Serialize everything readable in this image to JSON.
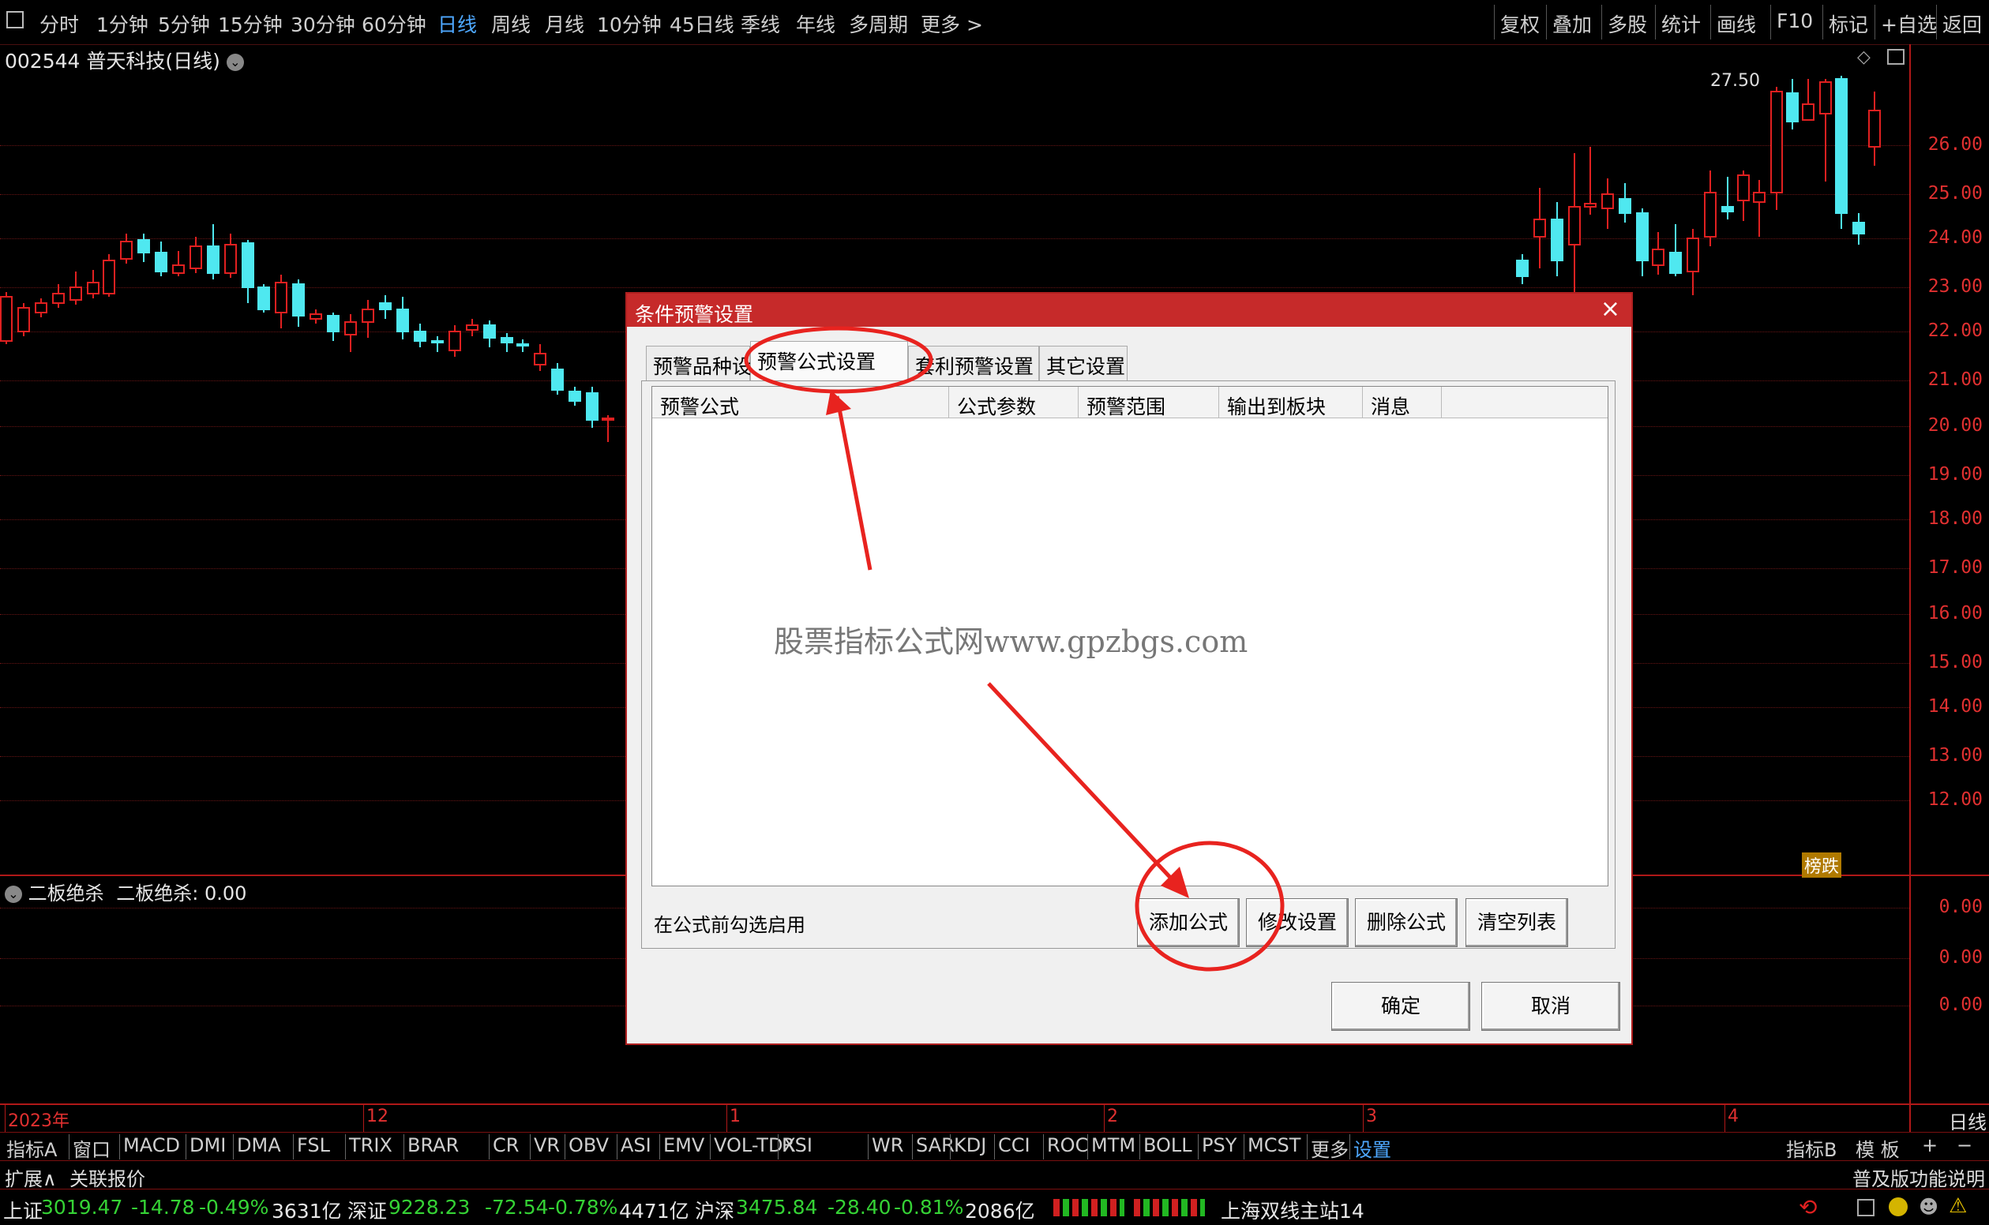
{
  "topbar": {
    "periods": [
      "分时",
      "1分钟",
      "5分钟",
      "15分钟",
      "30分钟",
      "60分钟",
      "日线",
      "周线",
      "月线",
      "10分钟",
      "45日线",
      "季线",
      "年线",
      "多周期",
      "更多 >"
    ],
    "active_period": "日线",
    "right_buttons": [
      "复权",
      "叠加",
      "多股",
      "统计",
      "画线",
      "F10",
      "标记",
      "+自选",
      "返回"
    ]
  },
  "ticker": {
    "code": "002544",
    "name": "普天科技",
    "period": "(日线)"
  },
  "price_axis": [
    "26.00",
    "25.00",
    "24.00",
    "23.00",
    "22.00",
    "21.00",
    "20.00",
    "19.00",
    "18.00",
    "17.00",
    "16.00",
    "15.00",
    "14.00",
    "13.00",
    "12.00"
  ],
  "max_price_label": "27.50",
  "badge": "榜跌",
  "watermark": "股票指标公式网www.gpzbgs.com",
  "indicator": {
    "name": "二板绝杀",
    "value_label": "二板绝杀: 0.00",
    "axis": [
      "0.00",
      "0.00",
      "0.00"
    ]
  },
  "time_axis": [
    "2023年",
    "12",
    "1",
    "2",
    "3",
    "4"
  ],
  "time_axis_period": "日线",
  "dialog": {
    "title": "条件预警设置",
    "close": "×",
    "tabs": [
      "预警品种设置",
      "预警公式设置",
      "套利预警设置",
      "其它设置"
    ],
    "active_tab": "预警公式设置",
    "columns": [
      "预警公式",
      "公式参数",
      "预警范围",
      "输出到板块",
      "消息"
    ],
    "hint": "在公式前勾选启用",
    "buttons": [
      "添加公式",
      "修改设置",
      "删除公式",
      "清空列表"
    ],
    "ok": "确定",
    "cancel": "取消"
  },
  "indicator_tabs": [
    "指标A",
    "窗口",
    "MACD",
    "DMI",
    "DMA",
    "FSL",
    "TRIX",
    "BRAR",
    "CR",
    "VR",
    "OBV",
    "ASI",
    "EMV",
    "VOL-TDX",
    "RSI",
    "WR",
    "SAR",
    "KDJ",
    "CCI",
    "ROC",
    "MTM",
    "BOLL",
    "PSY",
    "MCST",
    "更多",
    "设置"
  ],
  "indicator_tabs_selected": "设置",
  "indicator_tabs_right": [
    "指标B",
    "模 板",
    "+",
    "−"
  ],
  "ext_bar": {
    "left": [
      "扩展∧",
      "关联报价"
    ],
    "right": "普及版功能说明"
  },
  "status": {
    "sh_label": "上证",
    "sh_index": "3019.47",
    "sh_chg": "-14.78",
    "sh_pct": "-0.49%",
    "sh_amt": "3631亿",
    "sz_label": "深证",
    "sz_index": "9228.23",
    "sz_chg": "-72.54",
    "sz_pct": "-0.78%",
    "sz_amt": "4471亿",
    "hs_label": "沪深",
    "hs_index": "3475.84",
    "hs_chg": "-28.40",
    "hs_pct": "-0.81%",
    "hs_amt": "2086亿",
    "server": "上海双线主站14"
  },
  "colors": {
    "up": "#e02020",
    "down": "#4fe8f0",
    "accent": "#c62a2a"
  }
}
